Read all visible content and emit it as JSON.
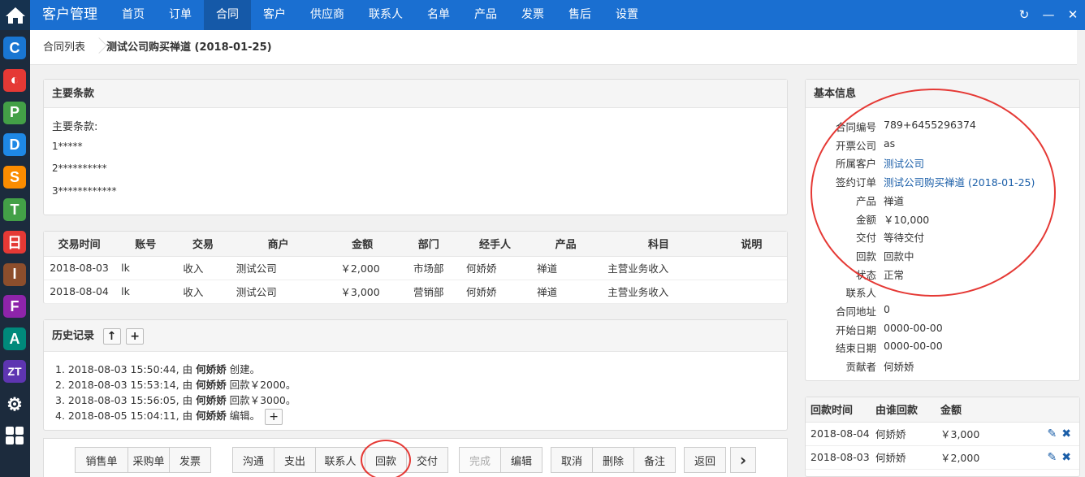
{
  "header": {
    "brand": "客户管理",
    "nav": [
      "首页",
      "订单",
      "合同",
      "客户",
      "供应商",
      "联系人",
      "名单",
      "产品",
      "发票",
      "售后",
      "设置"
    ],
    "active_nav": "合同",
    "tools": {
      "refresh": "↻",
      "minimize": "—",
      "close": "✕"
    }
  },
  "sidebar": {
    "apps": [
      {
        "letter": "C",
        "color": "#1976d2"
      },
      {
        "letter": "◐",
        "color": "#e53935"
      },
      {
        "letter": "P",
        "color": "#43a047"
      },
      {
        "letter": "D",
        "color": "#1e88e5"
      },
      {
        "letter": "S",
        "color": "#fb8c00"
      },
      {
        "letter": "T",
        "color": "#43a047"
      },
      {
        "letter": "日",
        "color": "#e53935"
      },
      {
        "letter": "I",
        "color": "#8d4e2c"
      },
      {
        "letter": "F",
        "color": "#8e24aa"
      },
      {
        "letter": "A",
        "color": "#00897b"
      },
      {
        "letter": "ZT",
        "color": "#5e35b1"
      }
    ]
  },
  "breadcrumb": {
    "list": "合同列表",
    "current": "测试公司购买禅道 (2018-01-25)"
  },
  "terms": {
    "title": "主要条款",
    "lines": [
      "主要条款:",
      "1*****",
      "2**********",
      "3************"
    ]
  },
  "transactions": {
    "headers": [
      "交易时间",
      "账号",
      "交易",
      "商户",
      "金额",
      "部门",
      "经手人",
      "产品",
      "科目",
      "说明"
    ],
    "rows": [
      [
        "2018-08-03",
        "lk",
        "收入",
        "测试公司",
        "￥2,000",
        "市场部",
        "何娇娇",
        "禅道",
        "主营业务收入",
        ""
      ],
      [
        "2018-08-04",
        "lk",
        "收入",
        "测试公司",
        "￥3,000",
        "营销部",
        "何娇娇",
        "禅道",
        "主营业务收入",
        ""
      ]
    ]
  },
  "history": {
    "title": "历史记录",
    "up_btn": "↑",
    "add_btn": "+",
    "entries": [
      {
        "pre": "1. 2018-08-03 15:50:44, 由 ",
        "who": "何娇娇",
        "post": " 创建。"
      },
      {
        "pre": "2. 2018-08-03 15:53:14, 由 ",
        "who": "何娇娇",
        "post": " 回款￥2000。"
      },
      {
        "pre": "3. 2018-08-03 15:56:05, 由 ",
        "who": "何娇娇",
        "post": " 回款￥3000。"
      },
      {
        "pre": "4. 2018-08-05 15:04:11, 由 ",
        "who": "何娇娇",
        "post": " 编辑。"
      }
    ],
    "add_note_btn": "+"
  },
  "toolbar": {
    "group1": [
      "销售单",
      "采购单",
      "发票"
    ],
    "group2": [
      "沟通",
      "支出",
      "联系人",
      "回款",
      "交付"
    ],
    "group3": [
      "完成",
      "编辑"
    ],
    "group4": [
      "取消",
      "删除",
      "备注"
    ],
    "back": "返回",
    "next": "›"
  },
  "info": {
    "title": "基本信息",
    "rows": [
      {
        "label": "合同编号",
        "value": "789+6455296374",
        "link": false
      },
      {
        "label": "开票公司",
        "value": "as",
        "link": false
      },
      {
        "label": "所属客户",
        "value": "测试公司",
        "link": true
      },
      {
        "label": "签约订单",
        "value": "测试公司购买禅道 (2018-01-25)",
        "link": true
      },
      {
        "label": "产品",
        "value": "禅道",
        "link": false
      },
      {
        "label": "金额",
        "value": "￥10,000",
        "link": false
      },
      {
        "label": "交付",
        "value": "等待交付",
        "link": false
      },
      {
        "label": "回款",
        "value": "回款中",
        "link": false
      },
      {
        "label": "状态",
        "value": "正常",
        "link": false
      },
      {
        "label": "联系人",
        "value": "",
        "link": false
      },
      {
        "label": "合同地址",
        "value": "0",
        "link": false
      },
      {
        "label": "开始日期",
        "value": "0000-00-00",
        "link": false
      },
      {
        "label": "结束日期",
        "value": "0000-00-00",
        "link": false
      },
      {
        "label": "贡献者",
        "value": "何娇娇",
        "link": false
      }
    ]
  },
  "payments": {
    "headers": [
      "回款时间",
      "由谁回款",
      "金额"
    ],
    "rows": [
      [
        "2018-08-04",
        "何娇娇",
        "￥3,000"
      ],
      [
        "2018-08-03",
        "何娇娇",
        "￥2,000"
      ]
    ]
  },
  "colors": {
    "header": "#1a6fd1",
    "link": "#1a5ea8",
    "annotation": "#e53935",
    "action_icon": "#1a5ea8"
  }
}
